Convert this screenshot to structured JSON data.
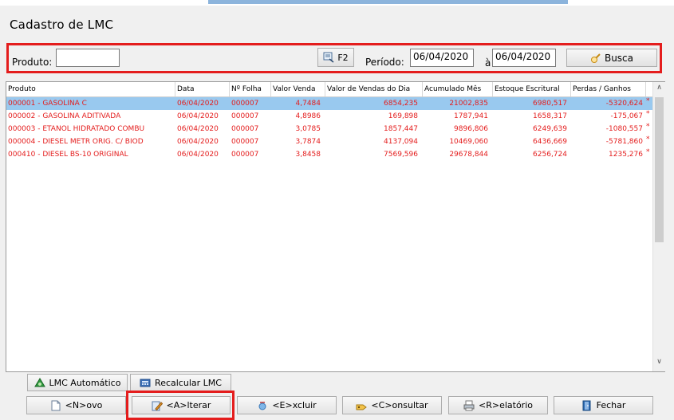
{
  "window": {
    "title": "Cadastro de LMC"
  },
  "search": {
    "produto_label": "Produto:",
    "produto_value": "",
    "f2_label": "F2",
    "periodo_label": "Período:",
    "date_from": "06/04/2020",
    "date_sep": "à",
    "date_to": "06/04/2020",
    "busca_label": "Busca"
  },
  "grid": {
    "headers": [
      "Produto",
      "Data",
      "Nº Folha",
      "Valor Venda",
      "Valor de Vendas do Dia",
      "Acumulado Mês",
      "Estoque Escritural",
      "Perdas / Ganhos"
    ],
    "rows": [
      [
        "000001 - GASOLINA C",
        "06/04/2020",
        "000007",
        "4,7484",
        "6854,235",
        "21002,835",
        "6980,517",
        "-5320,624"
      ],
      [
        "000002 - GASOLINA ADITIVADA",
        "06/04/2020",
        "000007",
        "4,8986",
        "169,898",
        "1787,941",
        "1658,317",
        "-175,067"
      ],
      [
        "000003 - ETANOL HIDRATADO COMBU",
        "06/04/2020",
        "000007",
        "3,0785",
        "1857,447",
        "9896,806",
        "6249,639",
        "-1080,557"
      ],
      [
        "000004 - DIESEL METR ORIG. C/ BIOD",
        "06/04/2020",
        "000007",
        "3,7874",
        "4137,094",
        "10469,060",
        "6436,669",
        "-5781,860"
      ],
      [
        "000410 - DIESEL BS-10 ORIGINAL",
        "06/04/2020",
        "000007",
        "3,8458",
        "7569,596",
        "29678,844",
        "6256,724",
        "1235,276"
      ]
    ],
    "row_marker": "*",
    "selected_row": 0,
    "text_color": "#e41d1d",
    "selection_color": "#99c9ef"
  },
  "actions": {
    "lmc_automatico": "LMC Automático",
    "recalcular": "Recalcular LMC",
    "novo": "<N>ovo",
    "alterar": "<A>lterar",
    "excluir": "<E>xcluir",
    "consultar": "<C>onsultar",
    "relatorio": "<R>elatório",
    "fechar": "Fechar"
  },
  "highlight_color": "#e41d1d"
}
